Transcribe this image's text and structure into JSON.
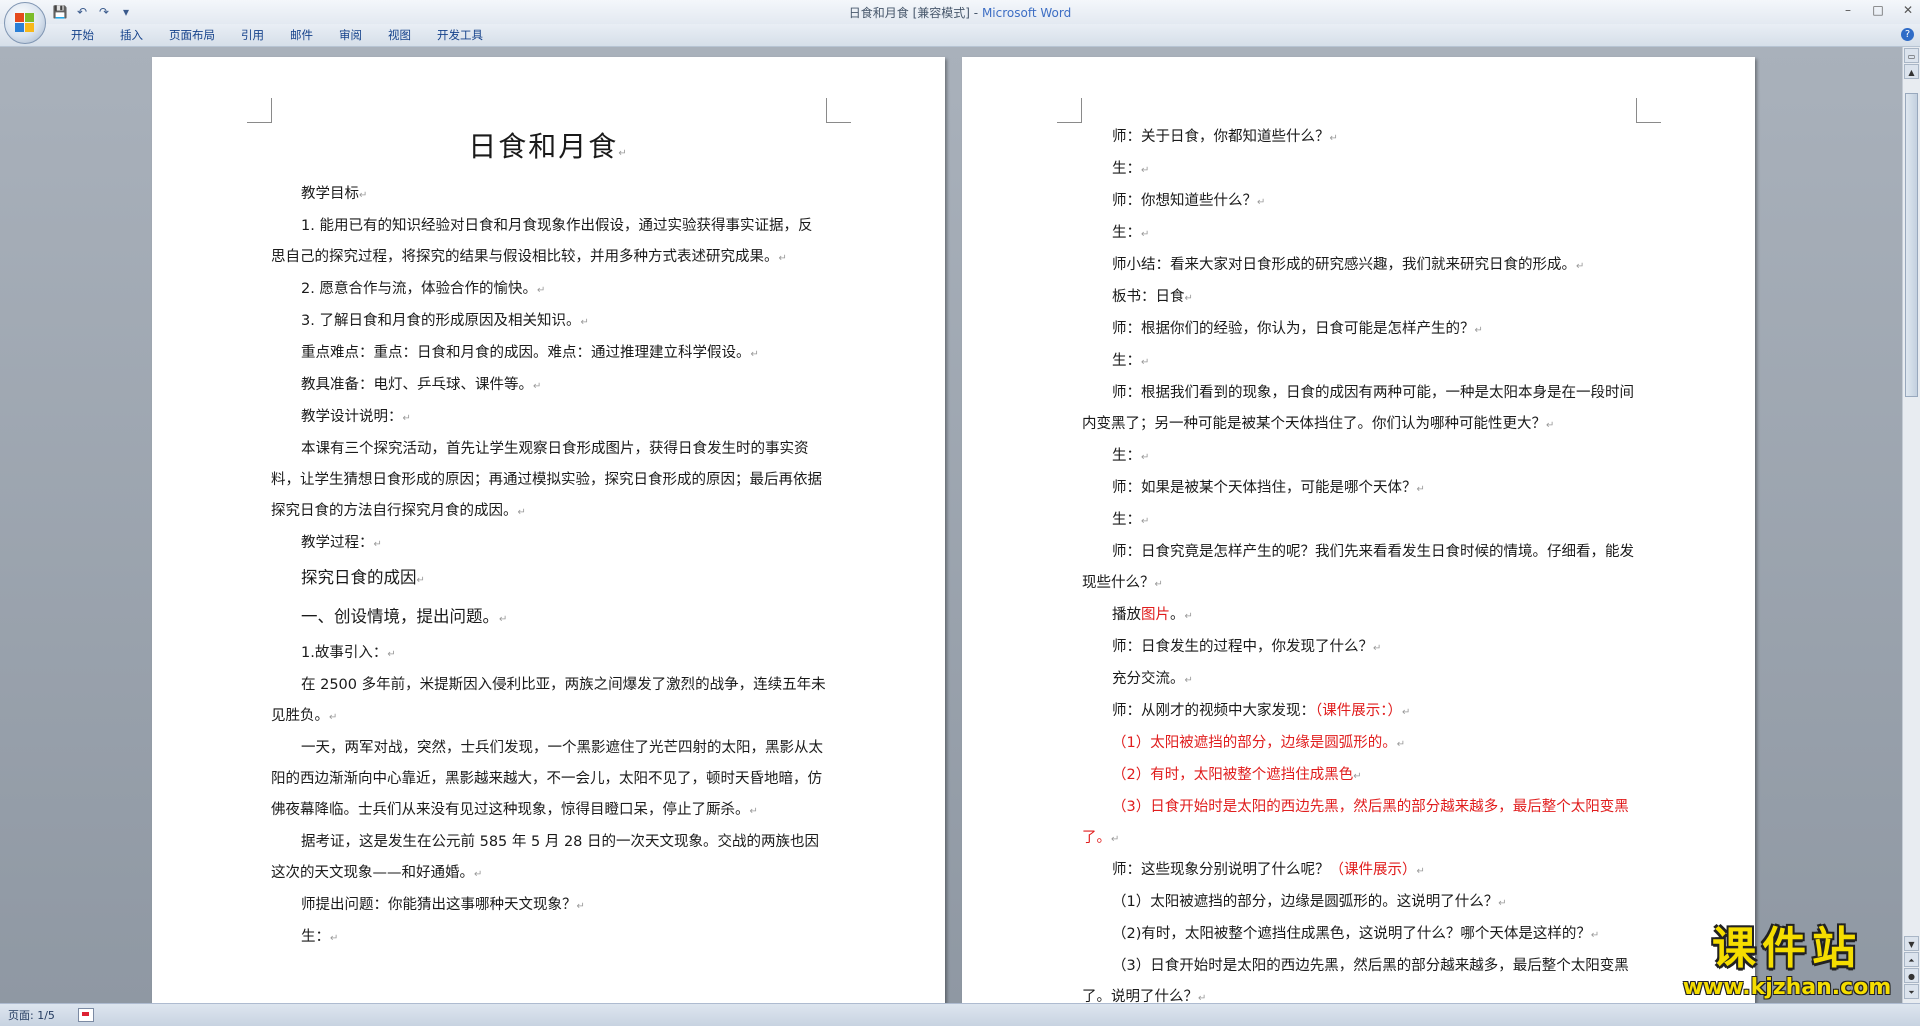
{
  "window": {
    "title": "日食和月食 [兼容模式]",
    "app_name": "Microsoft Word",
    "separator": " - "
  },
  "quick_access": [
    {
      "name": "save-icon",
      "glyph": "💾"
    },
    {
      "name": "undo-icon",
      "glyph": "↶"
    },
    {
      "name": "redo-icon",
      "glyph": "↷"
    },
    {
      "name": "customize-icon",
      "glyph": "▾"
    }
  ],
  "window_controls": {
    "minimize": "–",
    "maximize": "□",
    "close": "✕"
  },
  "ribbon": {
    "tabs": [
      "开始",
      "插入",
      "页面布局",
      "引用",
      "邮件",
      "审阅",
      "视图",
      "开发工具"
    ],
    "help": "?"
  },
  "pilcrow": "↵",
  "left_page": {
    "title": "日食和月食",
    "paragraphs": [
      {
        "text": "教学目标",
        "style": "ind"
      },
      {
        "text": "1. 能用已有的知识经验对日食和月食现象作出假设，通过实验获得事实证据，反思自己的探究过程，将探究的结果与假设相比较，并用多种方式表述研究成果。",
        "style": "ind"
      },
      {
        "text": "2. 愿意合作与流，体验合作的愉快。",
        "style": "ind"
      },
      {
        "text": "3. 了解日食和月食的形成原因及相关知识。",
        "style": "ind"
      },
      {
        "text": "重点难点：重点：日食和月食的成因。难点：通过推理建立科学假设。",
        "style": "ind"
      },
      {
        "text": "教具准备：电灯、乒乓球、课件等。",
        "style": "ind"
      },
      {
        "text": "教学设计说明：",
        "style": "ind"
      },
      {
        "text": "本课有三个探究活动，首先让学生观察日食形成图片，获得日食发生时的事实资料，让学生猜想日食形成的原因；再通过模拟实验，探究日食形成的原因；最后再依据探究日食的方法自行探究月食的成因。",
        "style": "ind"
      },
      {
        "text": "教学过程：",
        "style": "ind"
      },
      {
        "text": "探究日食的成因",
        "style": "h2"
      },
      {
        "text": "一、创设情境，提出问题。",
        "style": "h2"
      },
      {
        "text": "1.故事引入：",
        "style": "ind"
      },
      {
        "text": "在 2500 多年前，米提斯因入侵利比亚，两族之间爆发了激烈的战争，连续五年未见胜负。",
        "style": "ind"
      },
      {
        "text": "一天，两军对战，突然，士兵们发现，一个黑影遮住了光芒四射的太阳，黑影从太阳的西边渐渐向中心靠近，黑影越来越大，不一会儿，太阳不见了，顿时天昏地暗，仿佛夜幕降临。士兵们从来没有见过这种现象，惊得目瞪口呆，停止了厮杀。",
        "style": "ind"
      },
      {
        "text": "据考证，这是发生在公元前 585 年 5 月 28 日的一次天文现象。交战的两族也因这次的天文现象——和好通婚。",
        "style": "ind"
      },
      {
        "text": "师提出问题：你能猜出这事哪种天文现象？",
        "style": "ind"
      },
      {
        "text": "生：",
        "style": "ind"
      }
    ]
  },
  "right_page": {
    "paragraphs": [
      {
        "runs": [
          {
            "t": "师：关于日食，你都知道些什么？"
          }
        ]
      },
      {
        "runs": [
          {
            "t": "生："
          }
        ]
      },
      {
        "runs": [
          {
            "t": "师：你想知道些什么？"
          }
        ]
      },
      {
        "runs": [
          {
            "t": "生："
          }
        ]
      },
      {
        "runs": [
          {
            "t": "师小结：看来大家对日食形成的研究感兴趣，我们就来研究日食的形成。"
          }
        ]
      },
      {
        "runs": [
          {
            "t": "板书：日食"
          }
        ]
      },
      {
        "runs": [
          {
            "t": "师：根据你们的经验，你认为，日食可能是怎样产生的？"
          }
        ]
      },
      {
        "runs": [
          {
            "t": "生："
          }
        ]
      },
      {
        "runs": [
          {
            "t": "师：根据我们看到的现象，日食的成因有两种可能，一种是太阳本身是在一段时间内变黑了；另一种可能是被某个天体挡住了。你们认为哪种可能性更大？"
          }
        ]
      },
      {
        "runs": [
          {
            "t": "生："
          }
        ]
      },
      {
        "runs": [
          {
            "t": "师：如果是被某个天体挡住，可能是哪个天体？"
          }
        ]
      },
      {
        "runs": [
          {
            "t": "生："
          }
        ]
      },
      {
        "runs": [
          {
            "t": "师：日食究竟是怎样产生的呢？我们先来看看发生日食时候的情境。仔细看，能发现些什么？"
          }
        ]
      },
      {
        "runs": [
          {
            "t": "播放"
          },
          {
            "t": "图片",
            "red": true
          },
          {
            "t": "。"
          }
        ]
      },
      {
        "runs": [
          {
            "t": "师：日食发生的过程中，你发现了什么？"
          }
        ]
      },
      {
        "runs": [
          {
            "t": "充分交流。"
          }
        ]
      },
      {
        "runs": [
          {
            "t": "师：从刚才的视频中大家发现："
          },
          {
            "t": "（课件展示：）",
            "red": true
          }
        ]
      },
      {
        "runs": [
          {
            "t": "（1）太阳被遮挡的部分，边缘是圆弧形的。",
            "red": true
          }
        ]
      },
      {
        "runs": [
          {
            "t": "（2）有时，太阳被整个遮挡住成黑色",
            "red": true
          }
        ]
      },
      {
        "runs": [
          {
            "t": "（3）日食开始时是太阳的西边先黑，然后黑的部分越来越多，最后整个太阳变黑了。",
            "red": true
          }
        ]
      },
      {
        "runs": [
          {
            "t": "师：这些现象分别说明了什么呢？"
          },
          {
            "t": "（课件展示）",
            "red": true
          }
        ]
      },
      {
        "runs": [
          {
            "t": "（1）太阳被遮挡的部分，边缘是圆弧形的。这说明了什么？"
          }
        ]
      },
      {
        "runs": [
          {
            "t": "（2)有时，太阳被整个遮挡住成黑色，这说明了什么？哪个天体是这样的？"
          }
        ]
      },
      {
        "runs": [
          {
            "t": "（3）日食开始时是太阳的西边先黑，然后黑的部分越来越多，最后整个太阳变黑了。说明了什么？"
          }
        ]
      }
    ]
  },
  "statusbar": {
    "page": "页面: 1/5"
  },
  "watermark": {
    "title": "课件站",
    "url": "www.kjzhan.com"
  },
  "colors": {
    "accent": "#3d6ec4",
    "highlight_text": "#e01d1d",
    "watermark": "#f5dd00"
  }
}
